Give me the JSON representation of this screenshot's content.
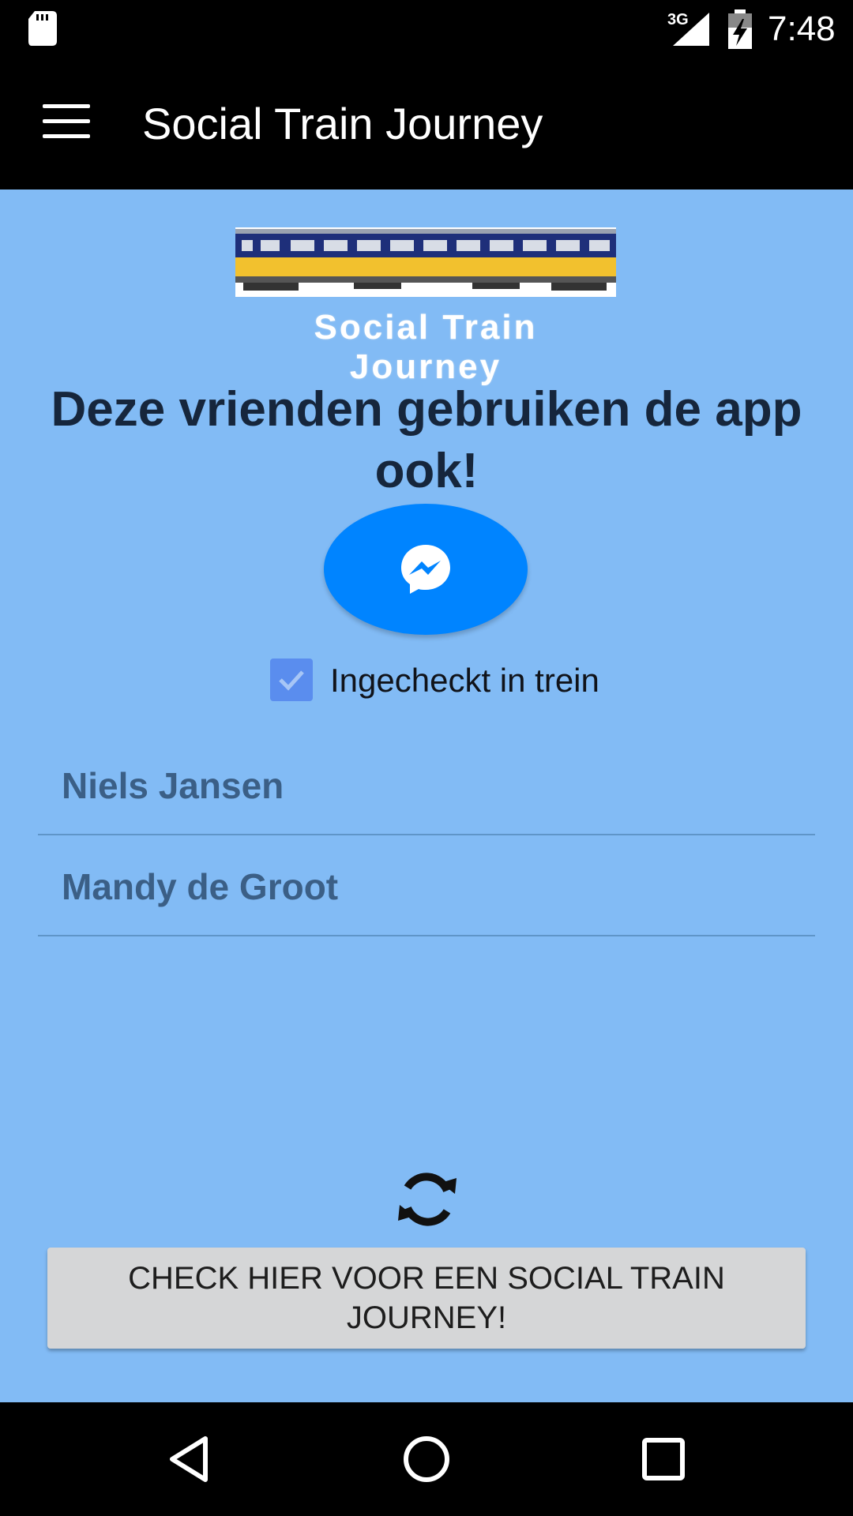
{
  "status_bar": {
    "network_type": "3G",
    "time": "7:48",
    "icons": [
      "sd-card-icon",
      "signal-icon",
      "battery-charging-icon"
    ]
  },
  "app_bar": {
    "title": "Social Train Journey",
    "menu_icon": "hamburger-menu-icon"
  },
  "logo": {
    "text": "Social Train Journey"
  },
  "main": {
    "heading": "Deze vrienden gebruiken de app ook!",
    "messenger_icon": "messenger-icon",
    "checkbox": {
      "label": "Ingecheckt in trein",
      "checked": true
    },
    "friends": [
      {
        "name": "Niels Jansen"
      },
      {
        "name": "Mandy de Groot"
      }
    ],
    "refresh_icon": "refresh-icon",
    "check_button_label": "CHECK HIER VOOR EEN SOCIAL TRAIN JOURNEY!"
  },
  "nav_bar": {
    "icons": [
      "back-icon",
      "home-icon",
      "recents-icon"
    ]
  },
  "colors": {
    "background": "#82bbf5",
    "messenger_blue": "#0084ff",
    "checkbox": "#5a8dee",
    "friend_text": "#3b5f86",
    "button_bg": "#d5d6d7"
  }
}
